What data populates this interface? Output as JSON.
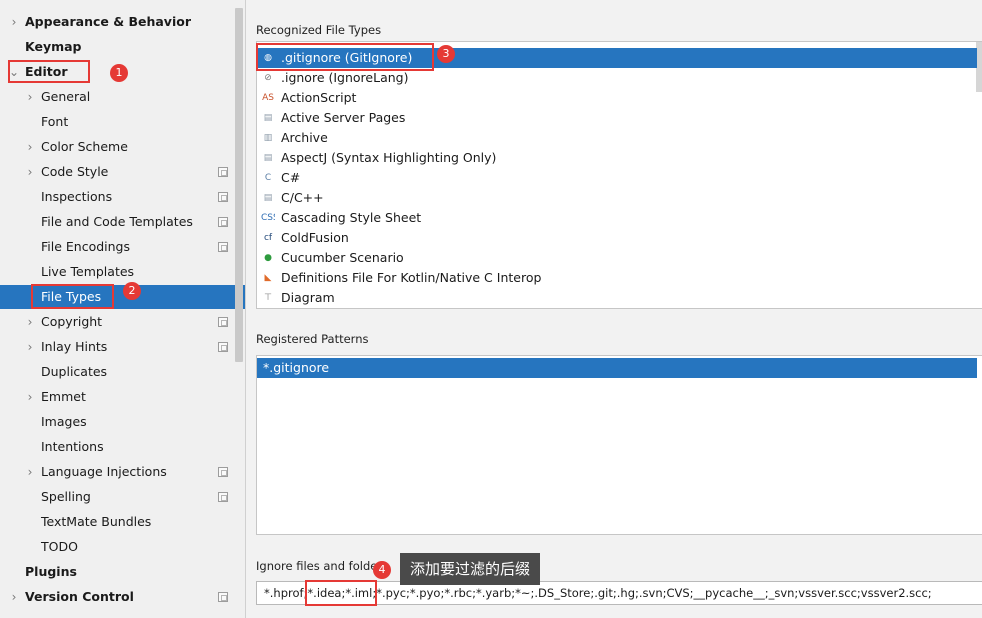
{
  "sidebar": {
    "items": [
      {
        "label": "Appearance & Behavior",
        "level": 0,
        "arrow": "›",
        "bold": true
      },
      {
        "label": "Keymap",
        "level": 0,
        "arrow": "",
        "bold": true
      },
      {
        "label": "Editor",
        "level": 0,
        "arrow": "⌄",
        "bold": true
      },
      {
        "label": "General",
        "level": 1,
        "arrow": "›"
      },
      {
        "label": "Font",
        "level": 1,
        "arrow": ""
      },
      {
        "label": "Color Scheme",
        "level": 1,
        "arrow": "›"
      },
      {
        "label": "Code Style",
        "level": 1,
        "arrow": "›",
        "proj": true
      },
      {
        "label": "Inspections",
        "level": 1,
        "arrow": "",
        "proj": true
      },
      {
        "label": "File and Code Templates",
        "level": 1,
        "arrow": "",
        "proj": true
      },
      {
        "label": "File Encodings",
        "level": 1,
        "arrow": "",
        "proj": true
      },
      {
        "label": "Live Templates",
        "level": 1,
        "arrow": ""
      },
      {
        "label": "File Types",
        "level": 1,
        "arrow": "",
        "selected": true
      },
      {
        "label": "Copyright",
        "level": 1,
        "arrow": "›",
        "proj": true
      },
      {
        "label": "Inlay Hints",
        "level": 1,
        "arrow": "›",
        "proj": true
      },
      {
        "label": "Duplicates",
        "level": 1,
        "arrow": ""
      },
      {
        "label": "Emmet",
        "level": 1,
        "arrow": "›"
      },
      {
        "label": "Images",
        "level": 1,
        "arrow": ""
      },
      {
        "label": "Intentions",
        "level": 1,
        "arrow": ""
      },
      {
        "label": "Language Injections",
        "level": 1,
        "arrow": "›",
        "proj": true
      },
      {
        "label": "Spelling",
        "level": 1,
        "arrow": "",
        "proj": true
      },
      {
        "label": "TextMate Bundles",
        "level": 1,
        "arrow": ""
      },
      {
        "label": "TODO",
        "level": 1,
        "arrow": ""
      },
      {
        "label": "Plugins",
        "level": 0,
        "arrow": "",
        "bold": true
      },
      {
        "label": "Version Control",
        "level": 0,
        "arrow": "›",
        "bold": true,
        "proj": true
      }
    ]
  },
  "recognized": {
    "label": "Recognized File Types",
    "items": [
      {
        "name": ".gitignore (GitIgnore)",
        "icon": "gitignore-icon",
        "glyph": "◍",
        "color": "#3b6fb6",
        "selected": true
      },
      {
        "name": ".ignore (IgnoreLang)",
        "icon": "ignore-icon",
        "glyph": "⊘",
        "color": "#777777"
      },
      {
        "name": "ActionScript",
        "icon": "actionscript-icon",
        "glyph": "AS",
        "color": "#c8512b"
      },
      {
        "name": "Active Server Pages",
        "icon": "asp-icon",
        "glyph": "▤",
        "color": "#8c9aa8"
      },
      {
        "name": "Archive",
        "icon": "archive-icon",
        "glyph": "▥",
        "color": "#8c9aa8"
      },
      {
        "name": "AspectJ (Syntax Highlighting Only)",
        "icon": "aspectj-icon",
        "glyph": "▤",
        "color": "#8c9aa8"
      },
      {
        "name": "C#",
        "icon": "csharp-icon",
        "glyph": "C",
        "color": "#5b7fa6"
      },
      {
        "name": "C/C++",
        "icon": "cpp-icon",
        "glyph": "▤",
        "color": "#8c9aa8"
      },
      {
        "name": "Cascading Style Sheet",
        "icon": "css-icon",
        "glyph": "CSS",
        "color": "#2f6db3"
      },
      {
        "name": "ColdFusion",
        "icon": "coldfusion-icon",
        "glyph": "cf",
        "color": "#244a7a"
      },
      {
        "name": "Cucumber Scenario",
        "icon": "cucumber-icon",
        "glyph": "●",
        "color": "#2e9b3e"
      },
      {
        "name": "Definitions File For Kotlin/Native C Interop",
        "icon": "kotlin-icon",
        "glyph": "◣",
        "color": "#e06b2b"
      },
      {
        "name": "Diagram",
        "icon": "diagram-icon",
        "glyph": "⊤",
        "color": "#7a7a7a"
      }
    ]
  },
  "registered": {
    "label": "Registered Patterns",
    "items": [
      {
        "name": "*.gitignore",
        "selected": true
      }
    ]
  },
  "ignore": {
    "label": "Ignore files and folders",
    "value": "*.hprof;*.idea;*.iml;*.pyc;*.pyo;*.rbc;*.yarb;*~;.DS_Store;.git;.hg;.svn;CVS;__pycache__;_svn;vssver.scc;vssver2.scc;"
  },
  "annotations": {
    "badges": [
      "1",
      "2",
      "3",
      "4"
    ],
    "tooltip": "添加要过滤的后缀"
  },
  "colors": {
    "selection": "#2675bf",
    "annotation": "#e53935"
  }
}
